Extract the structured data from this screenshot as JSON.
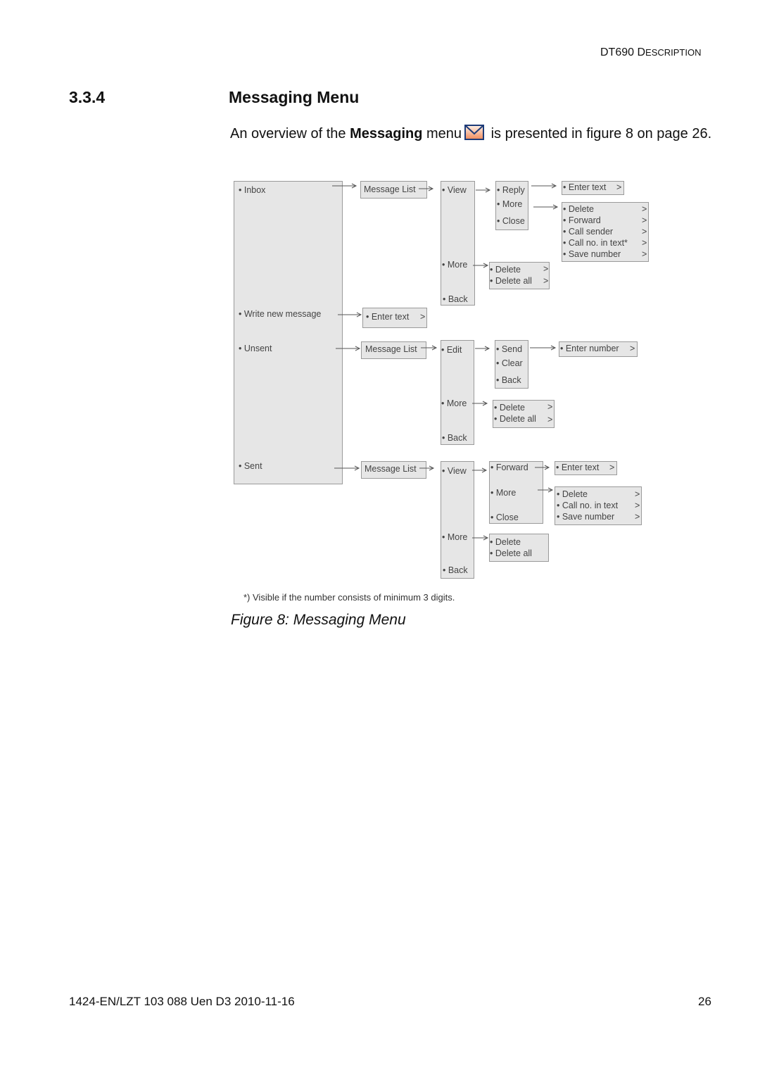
{
  "header": {
    "doc_title_main": "DT690 D",
    "doc_title_sc": "ESCRIPTION"
  },
  "section": {
    "number": "3.3.4",
    "title": "Messaging Menu"
  },
  "intro": {
    "pre": "An overview of the ",
    "bold": "Messaging",
    "mid": " menu",
    "post": " is presented in figure 8 on page 26.",
    "icon": "envelope-icon"
  },
  "diagram": {
    "root": [
      "• Inbox",
      "• Write new message",
      "• Unsent",
      "• Sent"
    ],
    "inbox": {
      "message_list": "Message List",
      "view_menu": [
        "• View",
        "• More",
        "• Back"
      ],
      "view_sub": [
        "• Reply",
        "• More",
        "• Close"
      ],
      "reply_sub": "• Enter text",
      "more_sub": [
        "• Delete",
        "• Forward",
        "• Call sender",
        "• Call no. in text*",
        "• Save number"
      ],
      "list_more": [
        "• Delete",
        "• Delete all"
      ]
    },
    "write": {
      "enter_text": "• Enter text"
    },
    "unsent": {
      "message_list": "Message List",
      "edit_menu": [
        "• Edit",
        "• More",
        "• Back"
      ],
      "edit_sub": [
        "• Send",
        "• Clear",
        "• Back"
      ],
      "send_sub": "• Enter number",
      "list_more": [
        "• Delete",
        "• Delete all"
      ]
    },
    "sent": {
      "message_list": "Message List",
      "view_menu": [
        "• View",
        "• More",
        "• Back"
      ],
      "view_sub": [
        "• Forward",
        "• More",
        "• Close"
      ],
      "forward_sub": "• Enter text",
      "more_sub": [
        "• Delete",
        "• Call no. in text",
        "• Save number"
      ],
      "list_more": [
        "• Delete",
        "• Delete all"
      ]
    },
    "chevron": ">"
  },
  "footnote": "*) Visible if the number consists of minimum 3 digits.",
  "caption": "Figure 8:  Messaging Menu",
  "footer": {
    "doc_id": "1424-EN/LZT 103 088 Uen D3 2010-11-16",
    "page": "26"
  }
}
